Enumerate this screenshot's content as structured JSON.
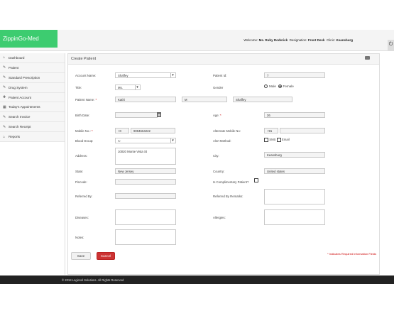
{
  "app": {
    "title": "ZippinGo-Med"
  },
  "header": {
    "welcome_label": "Welcome:",
    "user": "Ms. Ruby Roderick",
    "designation_label": "Designation:",
    "designation": "Front Desk",
    "clinic_label": "Clinic:",
    "clinic": "Keansburg"
  },
  "sidebar": {
    "items": [
      {
        "label": "Dashboard",
        "icon": "home-icon"
      },
      {
        "label": "Patient",
        "icon": "edit-icon"
      },
      {
        "label": "Standard Prescription",
        "icon": "edit-icon"
      },
      {
        "label": "Drug System",
        "icon": "edit-icon"
      },
      {
        "label": "Patient Account",
        "icon": "add-user-icon"
      },
      {
        "label": "Today's Appointments",
        "icon": "calendar-icon"
      },
      {
        "label": "Search Invoice",
        "icon": "edit-icon"
      },
      {
        "label": "Search Receipt",
        "icon": "edit-icon"
      },
      {
        "label": "Reports",
        "icon": "home-icon"
      }
    ]
  },
  "panel": {
    "title": "Create Patient"
  },
  "form": {
    "account_name": {
      "label": "Account Name:",
      "value": "Shaffey"
    },
    "patient_id": {
      "label": "Patient Id:",
      "value": "7"
    },
    "title": {
      "label": "Title:",
      "value": "Ms."
    },
    "gender": {
      "label": "Gender",
      "male": "Male",
      "female": "Female",
      "selected": "Female"
    },
    "patient_name": {
      "label": "Patient Name:",
      "required": "*",
      "first": "Kathi",
      "middle": "M",
      "last": "Shaffey"
    },
    "birth_date": {
      "label": "Birth Date:",
      "value": ""
    },
    "age": {
      "label": "Age:",
      "required": "*",
      "value": "26"
    },
    "mobile": {
      "label": "Mobile No.:",
      "required": "*",
      "code": "+0",
      "number": "9094664222"
    },
    "alt_mobile": {
      "label": "Alternate Mobile No:",
      "code": "+91",
      "number": ""
    },
    "blood_group": {
      "label": "Blood Group:",
      "value": "A-"
    },
    "alert_method": {
      "label": "Alert Method:",
      "sms": "SMS",
      "email": "Email"
    },
    "address": {
      "label": "Address:",
      "value": "10020 Monte Vista St"
    },
    "city": {
      "label": "City:",
      "value": "Keansburg"
    },
    "state": {
      "label": "State:",
      "value": "New Jersey"
    },
    "country": {
      "label": "Country:",
      "value": "United states"
    },
    "pincode": {
      "label": "Pincode:",
      "value": ""
    },
    "complimentary": {
      "label": "Is Complimentary Patient?"
    },
    "referred_by": {
      "label": "Referred By:"
    },
    "referred_remarks": {
      "label": "Referred By Remarks:"
    },
    "diseases": {
      "label": "Diseases:"
    },
    "allergies": {
      "label": "Allergies:"
    },
    "notes": {
      "label": "Notes:"
    },
    "required_note": "* Indicates Required Information Fields",
    "save": "Save",
    "cancel": "Cancel"
  },
  "footer": {
    "text": "© 2018 Logicsol Solutions. All Rights Reserved"
  },
  "colors": {
    "brand": "#3dcc70",
    "cancel": "#cc3333",
    "footer": "#222222",
    "required": "#cc0000"
  }
}
